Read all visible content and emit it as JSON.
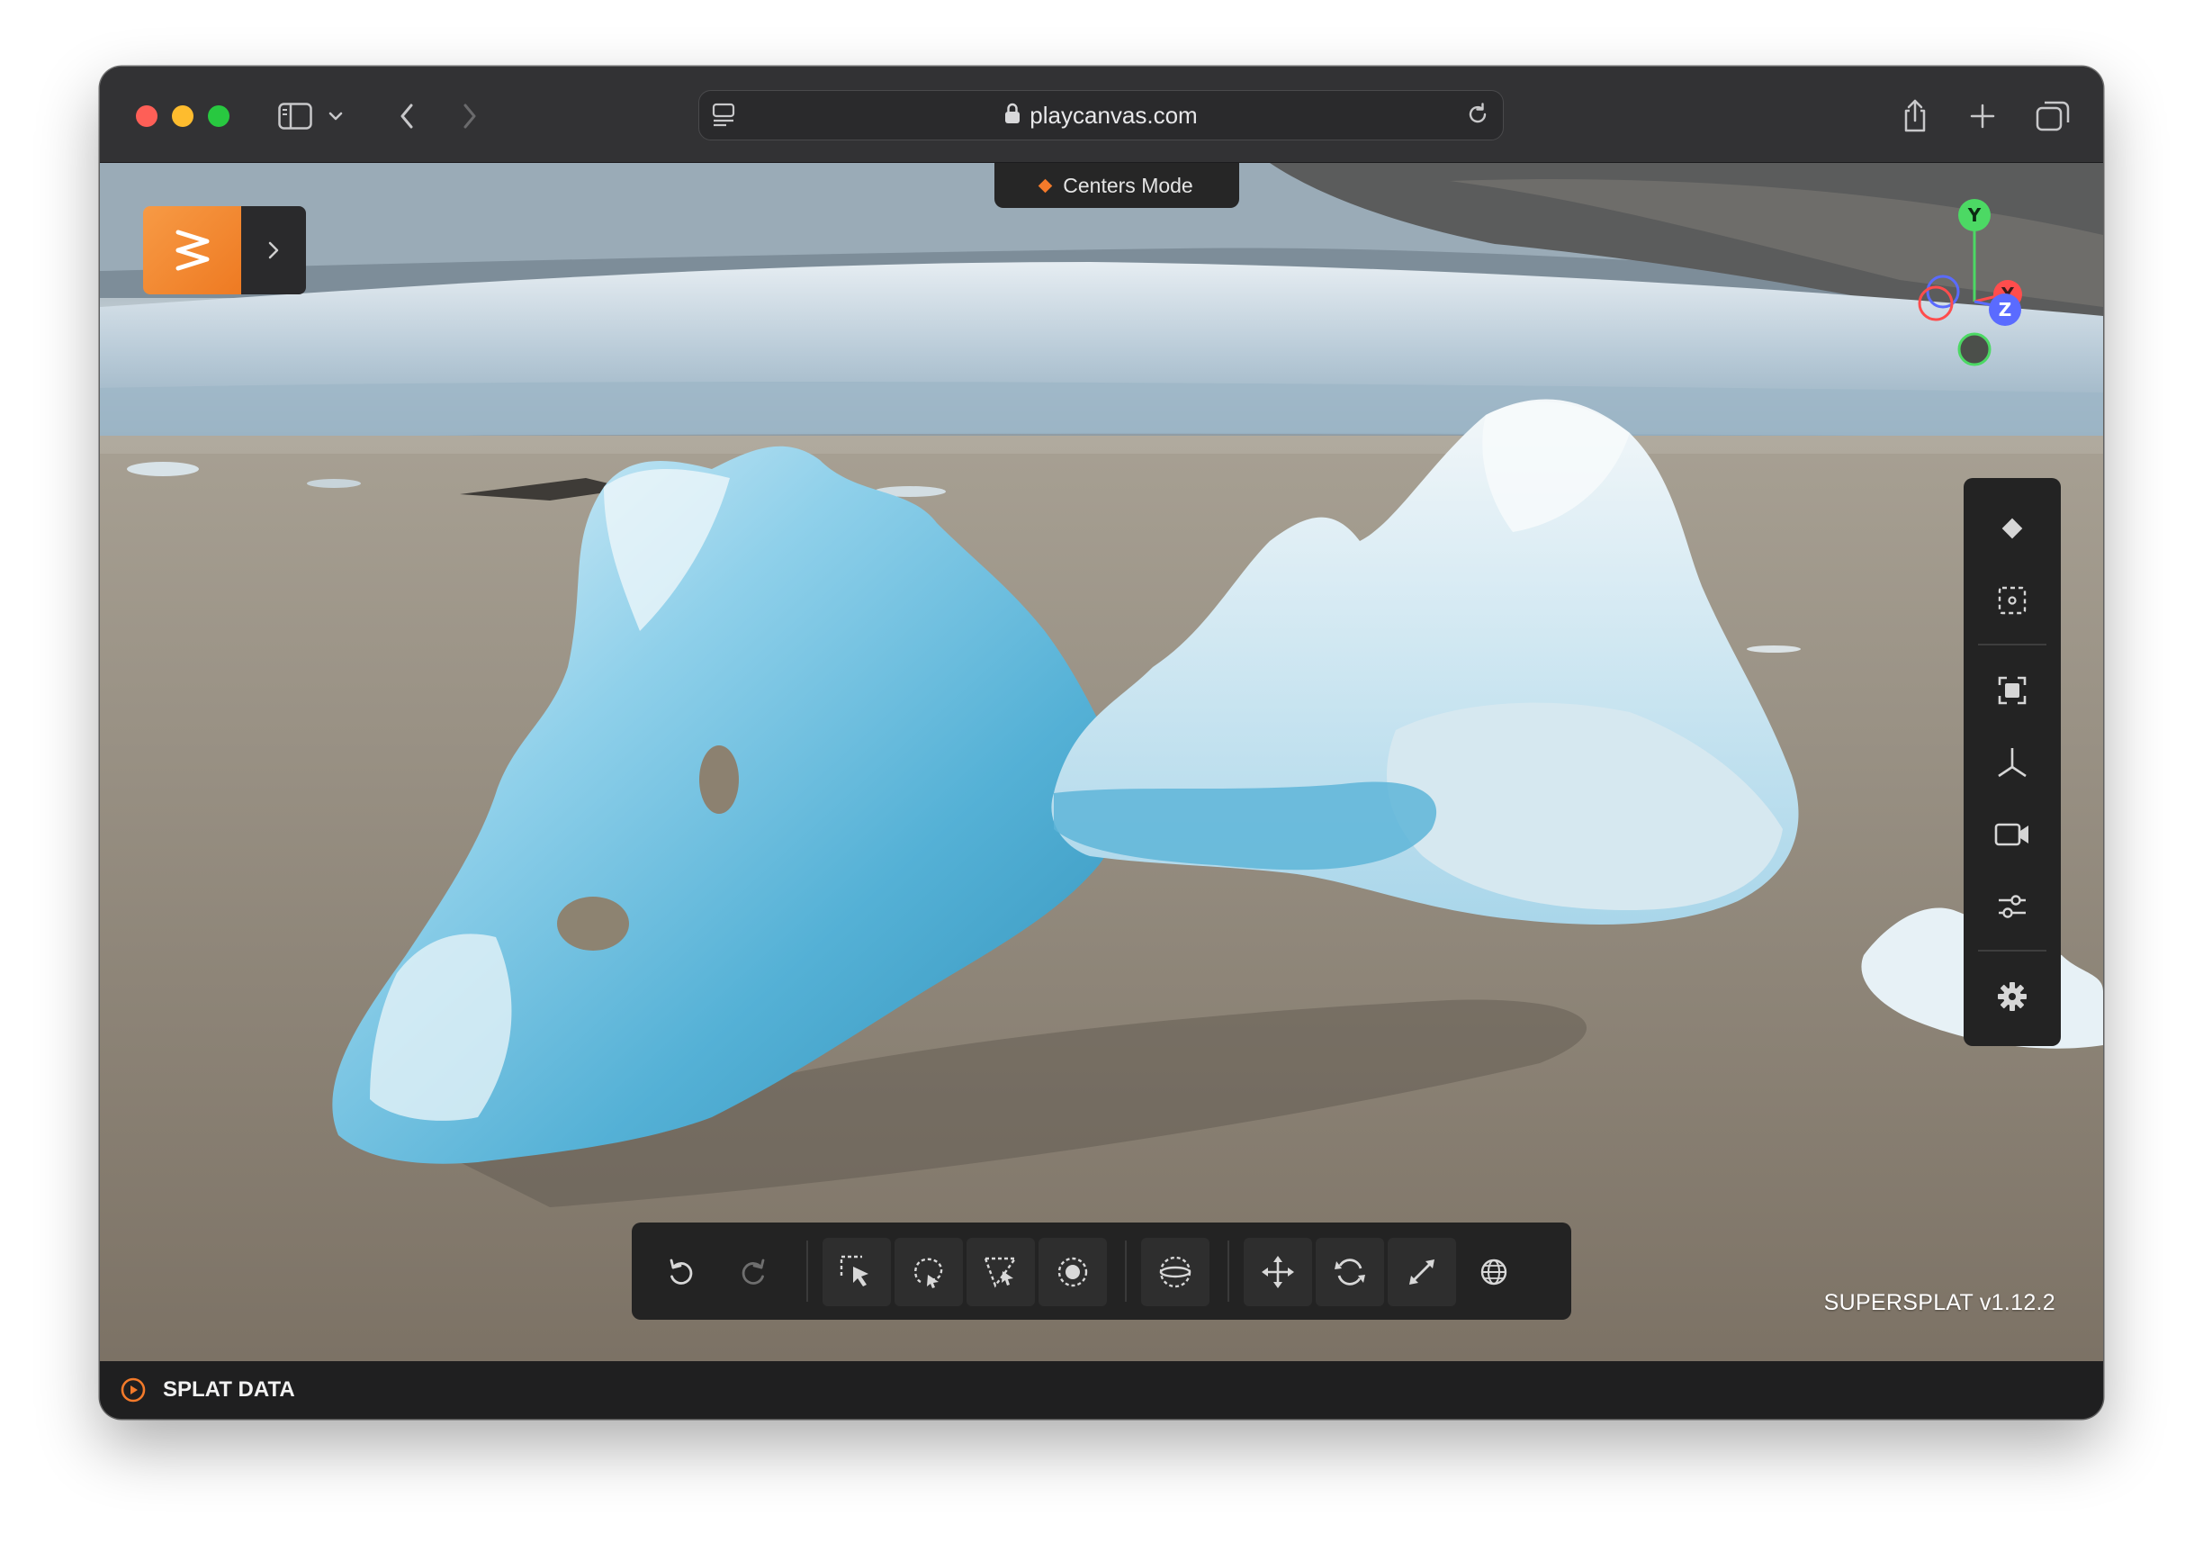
{
  "browser": {
    "url": "playcanvas.com",
    "traffic_colors": {
      "close": "#fe5f57",
      "minimize": "#febc2e",
      "zoom": "#28c840"
    },
    "icons": [
      "sidebar-icon",
      "chevron-down-icon",
      "back-icon",
      "forward-icon",
      "page-menu-icon",
      "lock-icon",
      "reload-icon",
      "share-icon",
      "new-tab-icon",
      "tab-overview-icon"
    ]
  },
  "app": {
    "mode_label": "Centers Mode",
    "version": "SUPERSPLAT v1.12.2",
    "accent_color": "#f37a2a",
    "gizmo": {
      "y": "Y",
      "x": "X",
      "z": "Z"
    },
    "right_toolbar": [
      "splat-mode-icon",
      "focus-selection-icon",
      "frame-selection-icon",
      "axes-icon",
      "camera-icon",
      "sliders-icon",
      "settings-gear-icon"
    ],
    "bottom_toolbar": [
      "undo-icon",
      "redo-icon",
      "rect-select-icon",
      "lasso-select-icon",
      "polygon-select-icon",
      "brush-select-icon",
      "sphere-select-icon",
      "move-icon",
      "rotate-icon",
      "scale-icon",
      "world-space-icon"
    ]
  },
  "statusbar": {
    "label": "SPLAT DATA"
  }
}
